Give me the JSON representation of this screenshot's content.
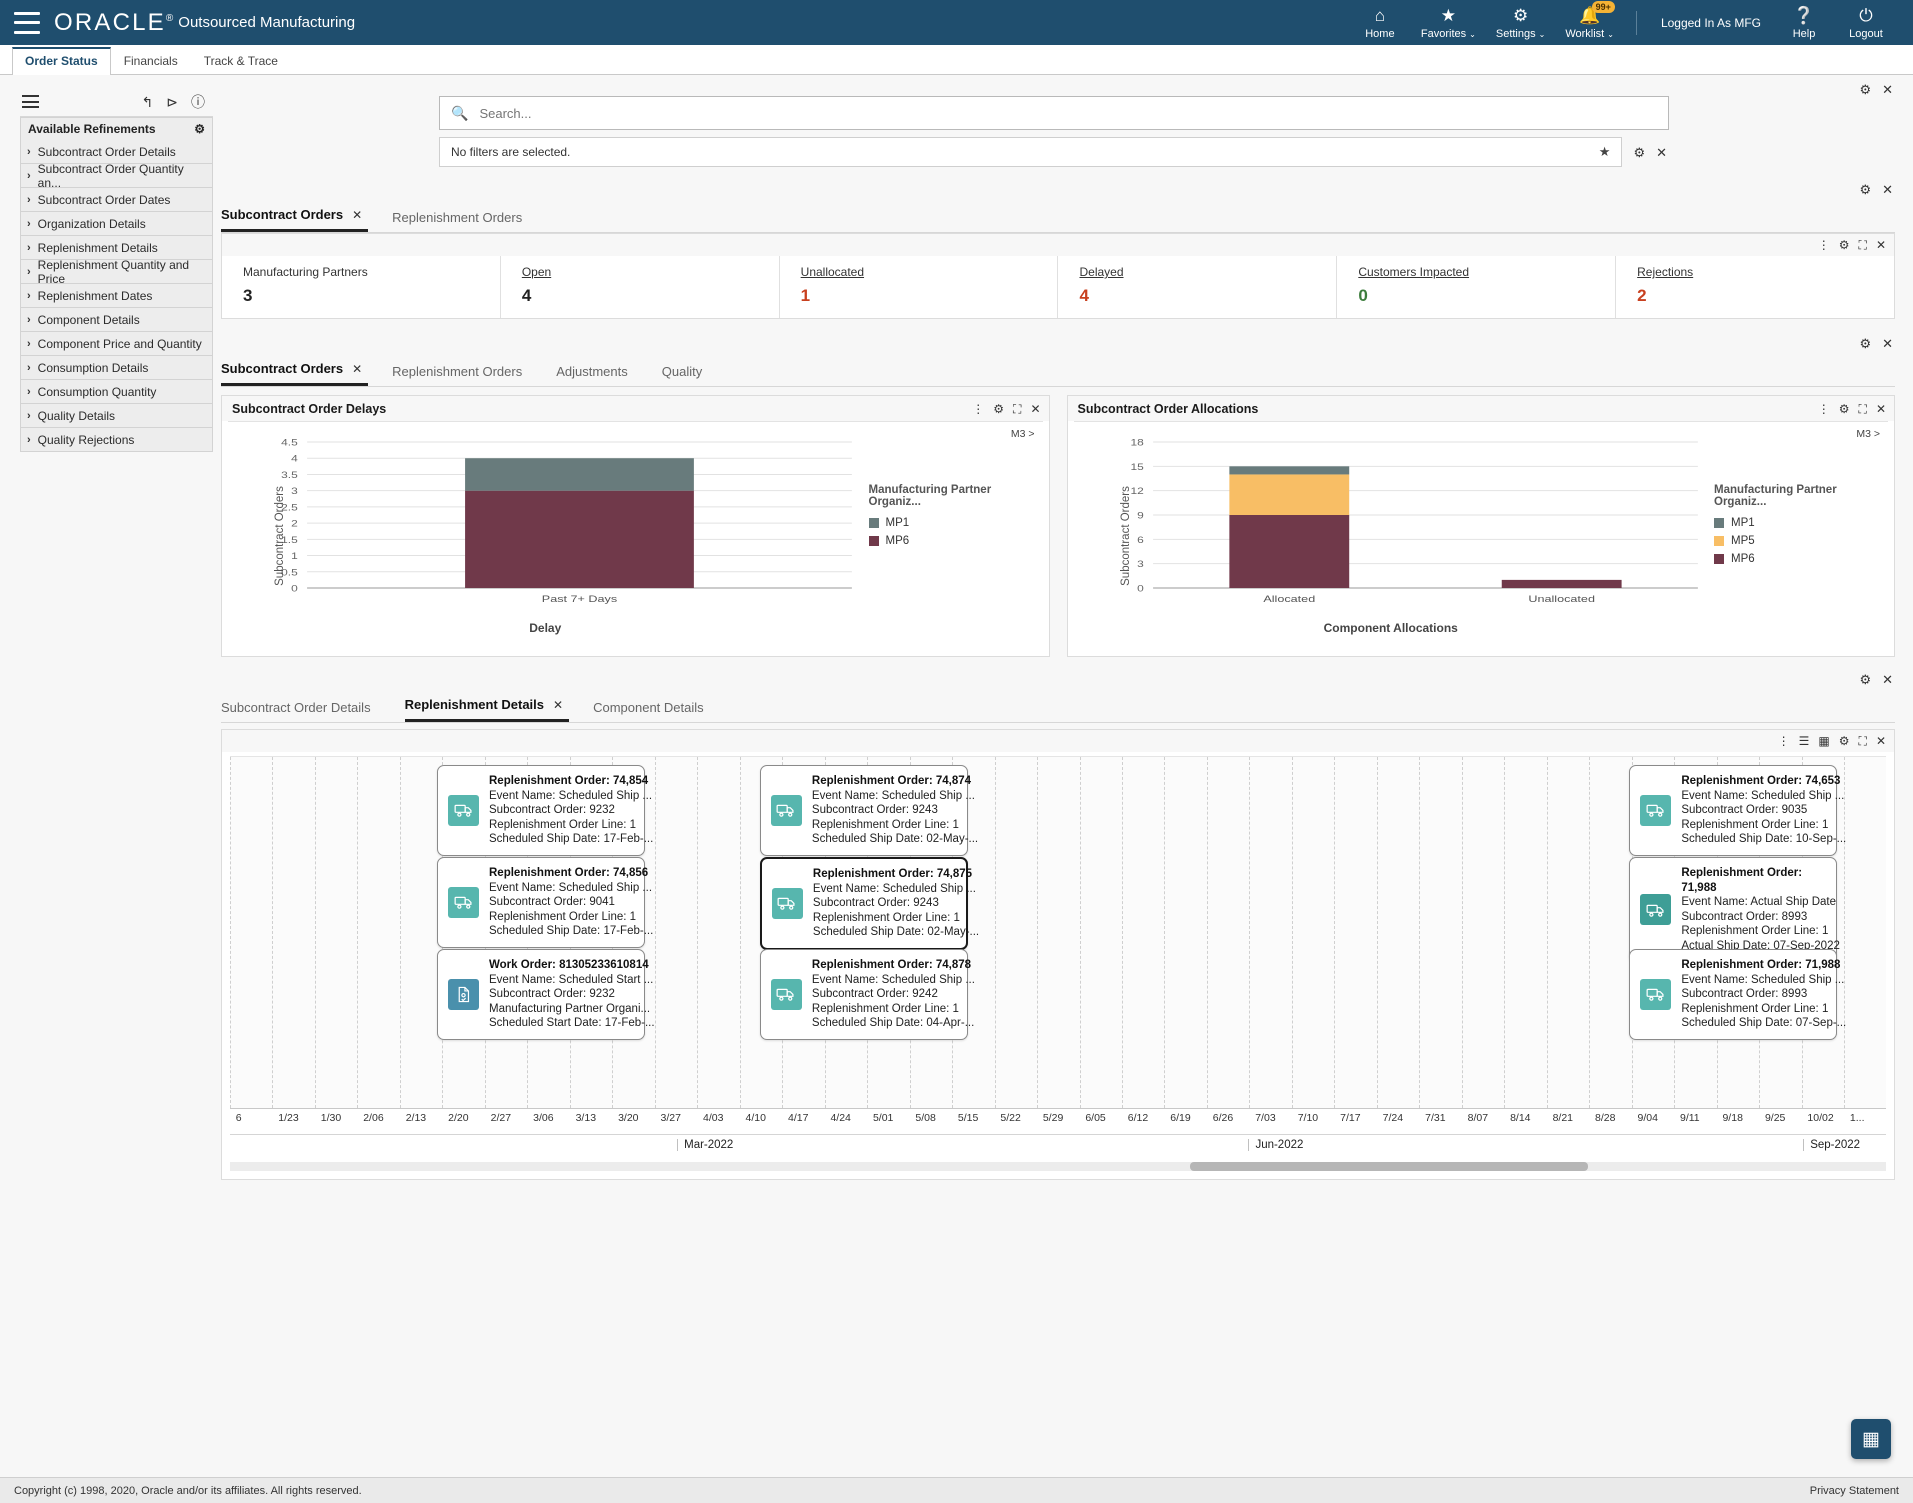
{
  "topbar": {
    "brand": "ORACLE",
    "brand_mark": "®",
    "app_name": "Outsourced Manufacturing",
    "menu_icon": "hamburger-icon",
    "nav": [
      {
        "label": "Home",
        "icon": "home-icon",
        "caret": "",
        "badge": ""
      },
      {
        "label": "Favorites",
        "icon": "star-icon",
        "caret": "⌄",
        "badge": ""
      },
      {
        "label": "Settings",
        "icon": "gear-icon",
        "caret": "⌄",
        "badge": ""
      },
      {
        "label": "Worklist",
        "icon": "bell-icon",
        "caret": "⌄",
        "badge": "99+"
      }
    ],
    "logged_in": "Logged In As MFG",
    "help": {
      "label": "Help",
      "icon": "help-icon"
    },
    "logout": {
      "label": "Logout",
      "icon": "power-icon"
    }
  },
  "app_tabs": [
    {
      "label": "Order Status",
      "active": true
    },
    {
      "label": "Financials",
      "active": false
    },
    {
      "label": "Track & Trace",
      "active": false
    }
  ],
  "sidebar": {
    "toolbar_icons": [
      "menu-icon",
      "undo-icon",
      "share-icon",
      "info-icon"
    ],
    "header": "Available Refinements",
    "header_icon": "gear-icon",
    "items": [
      {
        "label": "Subcontract Order Details"
      },
      {
        "label": "Subcontract Order Quantity an..."
      },
      {
        "label": "Subcontract Order Dates"
      },
      {
        "label": "Organization Details"
      },
      {
        "label": "Replenishment Details"
      },
      {
        "label": "Replenishment Quantity and Price"
      },
      {
        "label": "Replenishment Dates"
      },
      {
        "label": "Component Details"
      },
      {
        "label": "Component Price and Quantity"
      },
      {
        "label": "Consumption Details"
      },
      {
        "label": "Consumption Quantity"
      },
      {
        "label": "Quality Details"
      },
      {
        "label": "Quality Rejections"
      }
    ]
  },
  "search": {
    "placeholder": "Search...",
    "icon": "search-icon",
    "filters_text": "No filters are selected.",
    "star_icon": "star-icon"
  },
  "kpi_tabs": [
    {
      "label": "Subcontract Orders",
      "active": true,
      "close": "✕"
    },
    {
      "label": "Replenishment Orders",
      "active": false
    }
  ],
  "kpis": [
    {
      "label": "Manufacturing Partners",
      "value": "3",
      "color": "#222222",
      "link": false
    },
    {
      "label": "Open",
      "value": "4",
      "color": "#222222",
      "link": true
    },
    {
      "label": "Unallocated",
      "value": "1",
      "color": "#c8401f",
      "link": true
    },
    {
      "label": "Delayed",
      "value": "4",
      "color": "#c8401f",
      "link": true
    },
    {
      "label": "Customers Impacted",
      "value": "0",
      "color": "#3c7d3c",
      "link": true
    },
    {
      "label": "Rejections",
      "value": "2",
      "color": "#c8401f",
      "link": true
    }
  ],
  "chart_tabs": [
    {
      "label": "Subcontract Orders",
      "active": true,
      "close": "✕"
    },
    {
      "label": "Replenishment Orders",
      "active": false
    },
    {
      "label": "Adjustments",
      "active": false
    },
    {
      "label": "Quality",
      "active": false
    }
  ],
  "chart_data": [
    {
      "type": "bar",
      "stacked": true,
      "title": "Subcontract Order Delays",
      "zoom_label": "M3 >",
      "categories": [
        "Past 7+ Days"
      ],
      "series": [
        {
          "name": "MP1",
          "values": [
            1
          ],
          "color": "#687b7c"
        },
        {
          "name": "MP6",
          "values": [
            3
          ],
          "color": "#70394a"
        }
      ],
      "legend_title": "Manufacturing Partner Organiz...",
      "legend_position": "right",
      "xlabel": "Delay",
      "ylabel": "Subcontract Orders",
      "ylim": [
        0,
        4.5
      ],
      "yticks": [
        "4.5",
        "4",
        "3.5",
        "3",
        "2.5",
        "2",
        "1.5",
        "1",
        "0.5",
        "0"
      ],
      "grid": true
    },
    {
      "type": "bar",
      "stacked": true,
      "title": "Subcontract Order Allocations",
      "zoom_label": "M3 >",
      "categories": [
        "Allocated",
        "Unallocated"
      ],
      "series": [
        {
          "name": "MP1",
          "values": [
            1,
            0
          ],
          "color": "#687b7c"
        },
        {
          "name": "MP5",
          "values": [
            5,
            0
          ],
          "color": "#f8be65"
        },
        {
          "name": "MP6",
          "values": [
            9,
            1
          ],
          "color": "#70394a"
        }
      ],
      "legend_title": "Manufacturing Partner Organiz...",
      "legend_position": "right",
      "xlabel": "Component Allocations",
      "ylabel": "Subcontract Orders",
      "ylim": [
        0,
        18
      ],
      "yticks": [
        "18",
        "15",
        "12",
        "9",
        "6",
        "3",
        "0"
      ],
      "grid": true
    }
  ],
  "detail_tabs": [
    {
      "label": "Subcontract Order Details",
      "active": false
    },
    {
      "label": "Replenishment Details",
      "active": true,
      "close": "✕"
    },
    {
      "label": "Component Details",
      "active": false
    }
  ],
  "timeline": {
    "events": [
      {
        "title": "Replenishment Order: 74,854",
        "icon": "truck-icon",
        "icon_type": "ship",
        "lines": [
          "Event Name: Scheduled Ship ...",
          "Subcontract Order: 9232",
          "Replenishment Order Line: 1",
          "Scheduled Ship Date: 17-Feb-..."
        ],
        "selected": false,
        "col": 0,
        "row": 0
      },
      {
        "title": "Replenishment Order: 74,856",
        "icon": "truck-icon",
        "icon_type": "ship",
        "lines": [
          "Event Name: Scheduled Ship ...",
          "Subcontract Order: 9041",
          "Replenishment Order Line: 1",
          "Scheduled Ship Date: 17-Feb-..."
        ],
        "selected": false,
        "col": 0,
        "row": 1
      },
      {
        "title": "Work Order: 81305233610814",
        "icon": "document-icon",
        "icon_type": "work",
        "lines": [
          "Event Name: Scheduled Start ...",
          "Subcontract Order: 9232",
          "Manufacturing Partner Organi...",
          "Scheduled Start Date: 17-Feb-..."
        ],
        "selected": false,
        "col": 0,
        "row": 2
      },
      {
        "title": "Replenishment Order: 74,874",
        "icon": "truck-icon",
        "icon_type": "ship",
        "lines": [
          "Event Name: Scheduled Ship ...",
          "Subcontract Order: 9243",
          "Replenishment Order Line: 1",
          "Scheduled Ship Date: 02-May-..."
        ],
        "selected": false,
        "col": 1,
        "row": 0
      },
      {
        "title": "Replenishment Order: 74,875",
        "icon": "truck-icon",
        "icon_type": "ship",
        "lines": [
          "Event Name: Scheduled Ship ...",
          "Subcontract Order: 9243",
          "Replenishment Order Line: 1",
          "Scheduled Ship Date: 02-May-..."
        ],
        "selected": true,
        "col": 1,
        "row": 1
      },
      {
        "title": "Replenishment Order: 74,878",
        "icon": "truck-icon",
        "icon_type": "ship",
        "lines": [
          "Event Name: Scheduled Ship ...",
          "Subcontract Order: 9242",
          "Replenishment Order Line: 1",
          "Scheduled Ship Date: 04-Apr-..."
        ],
        "selected": false,
        "col": 1,
        "row": 2
      },
      {
        "title": "Replenishment Order: 74,653",
        "icon": "truck-icon",
        "icon_type": "ship",
        "lines": [
          "Event Name: Scheduled Ship ...",
          "Subcontract Order: 9035",
          "Replenishment Order Line: 1",
          "Scheduled Ship Date: 10-Sep-..."
        ],
        "selected": false,
        "col": 2,
        "row": 0
      },
      {
        "title": "Replenishment Order: 71,988",
        "icon": "truck-icon",
        "icon_type": "actual",
        "lines": [
          "Event Name: Actual Ship Date",
          "Subcontract Order: 8993",
          "Replenishment Order Line: 1",
          "Actual Ship Date: 07-Sep-2022"
        ],
        "selected": false,
        "col": 2,
        "row": 1
      },
      {
        "title": "Replenishment Order: 71,988",
        "icon": "truck-icon",
        "icon_type": "ship",
        "lines": [
          "Event Name: Scheduled Ship ...",
          "Subcontract Order: 8993",
          "Replenishment Order Line: 1",
          "Scheduled Ship Date: 07-Sep-..."
        ],
        "selected": false,
        "col": 2,
        "row": 2
      }
    ],
    "ticks": [
      "6",
      "1/23",
      "1/30",
      "2/06",
      "2/13",
      "2/20",
      "2/27",
      "3/06",
      "3/13",
      "3/20",
      "3/27",
      "4/03",
      "4/10",
      "4/17",
      "4/24",
      "5/01",
      "5/08",
      "5/15",
      "5/22",
      "5/29",
      "6/05",
      "6/12",
      "6/19",
      "6/26",
      "7/03",
      "7/10",
      "7/17",
      "7/24",
      "7/31",
      "8/07",
      "8/14",
      "8/21",
      "8/28",
      "9/04",
      "9/11",
      "9/18",
      "9/25",
      "10/02",
      "1..."
    ],
    "months": [
      {
        "label": "Mar-2022",
        "pos": 27
      },
      {
        "label": "Jun-2022",
        "pos": 61.5
      },
      {
        "label": "Sep-2022",
        "pos": 95
      }
    ]
  },
  "fab": {
    "icon": "grid-icon"
  },
  "footer": {
    "copyright": "Copyright (c) 1998, 2020, Oracle and/or its affiliates. All rights reserved.",
    "privacy": "Privacy Statement"
  }
}
